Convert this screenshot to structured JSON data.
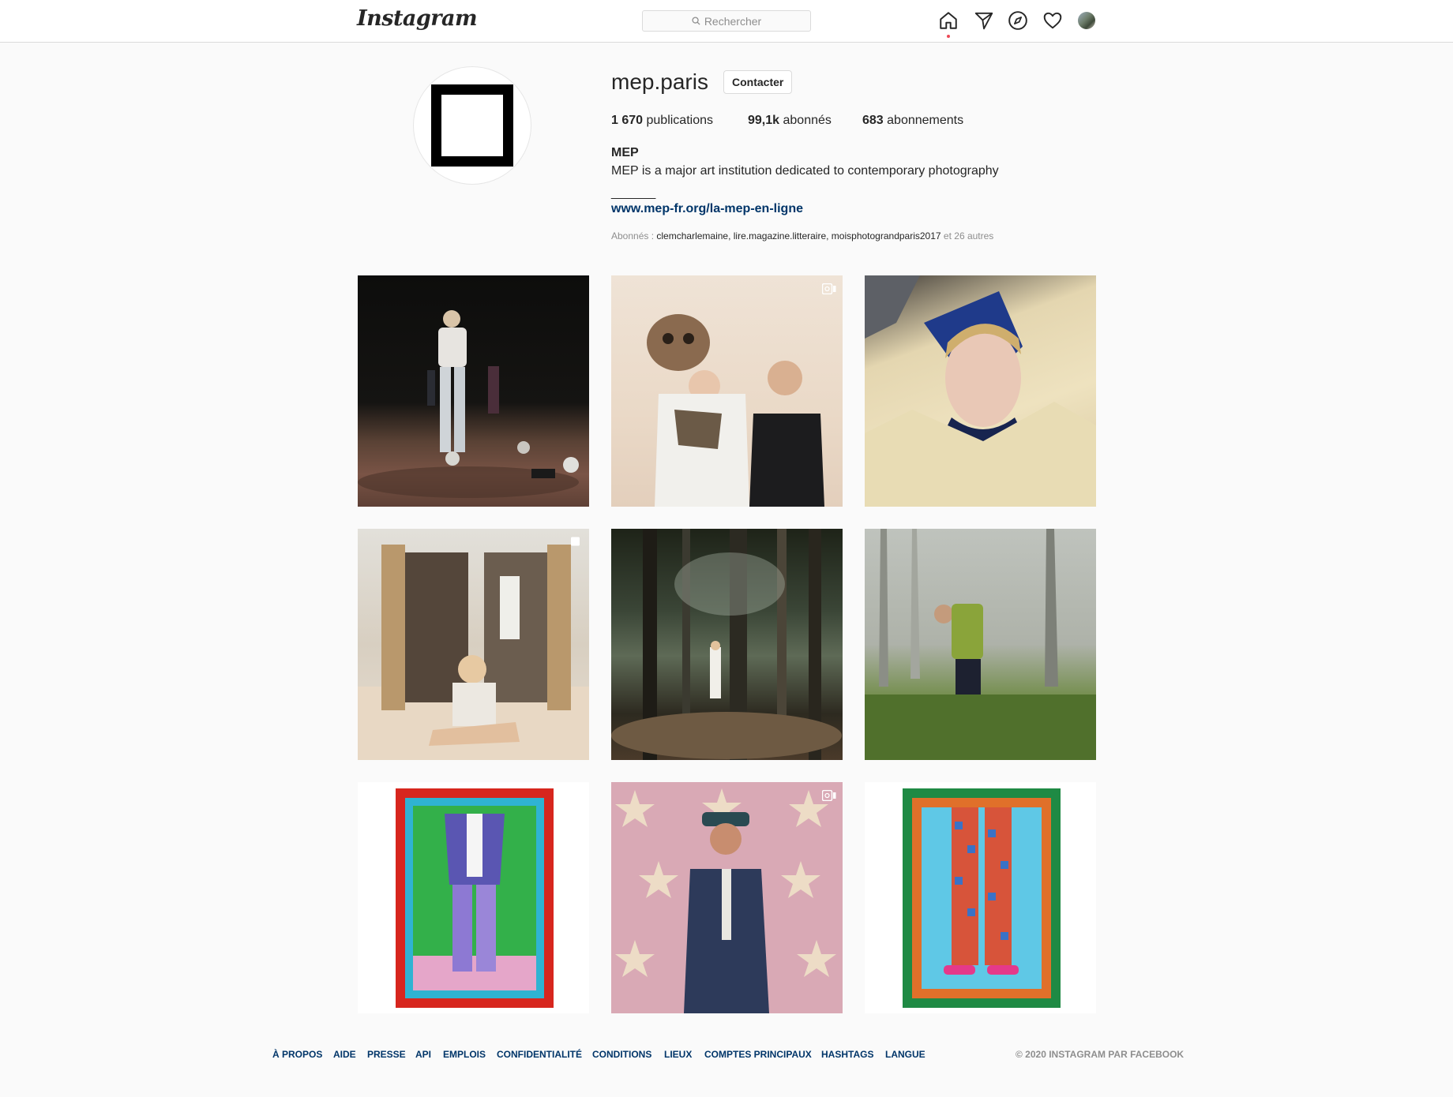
{
  "header": {
    "logo": "Instagram",
    "search_placeholder": "Rechercher",
    "icons": [
      "home-icon",
      "direct-icon",
      "explore-icon",
      "activity-heart-icon",
      "profile-avatar"
    ]
  },
  "profile": {
    "username": "mep.paris",
    "contact_label": "Contacter",
    "stats": {
      "posts_count": "1 670",
      "posts_label": "publications",
      "followers_count": "99,1k",
      "followers_label": "abonnés",
      "following_count": "683",
      "following_label": "abonnements"
    },
    "bio": {
      "name": "MEP",
      "text": "MEP is a major art institution dedicated to contemporary photography",
      "separator": "_______",
      "link": "www.mep-fr.org/la-mep-en-ligne"
    },
    "followed_by": {
      "prefix": "Abonnés :",
      "names": "clemcharlemaine, lire.magazine.litteraire, moisphotograndparis2017",
      "suffix": "et 26 autres"
    }
  },
  "posts": [
    {
      "type": "photo"
    },
    {
      "type": "video",
      "badge": "video-icon"
    },
    {
      "type": "photo"
    },
    {
      "type": "carousel",
      "badge": "carousel-icon"
    },
    {
      "type": "photo"
    },
    {
      "type": "photo"
    },
    {
      "type": "photo"
    },
    {
      "type": "video",
      "badge": "video-icon"
    },
    {
      "type": "photo"
    }
  ],
  "footer": {
    "links": [
      "À propos",
      "Aide",
      "Presse",
      "API",
      "Emplois",
      "Confidentialité",
      "Conditions",
      "Lieux",
      "Comptes principaux",
      "Hashtags",
      "Langue"
    ],
    "copyright": "© 2020 Instagram par Facebook"
  },
  "colors": {
    "link": "#003569",
    "muted": "#8e8e8e",
    "text": "#262626",
    "notification_dot": "#ed4956"
  }
}
